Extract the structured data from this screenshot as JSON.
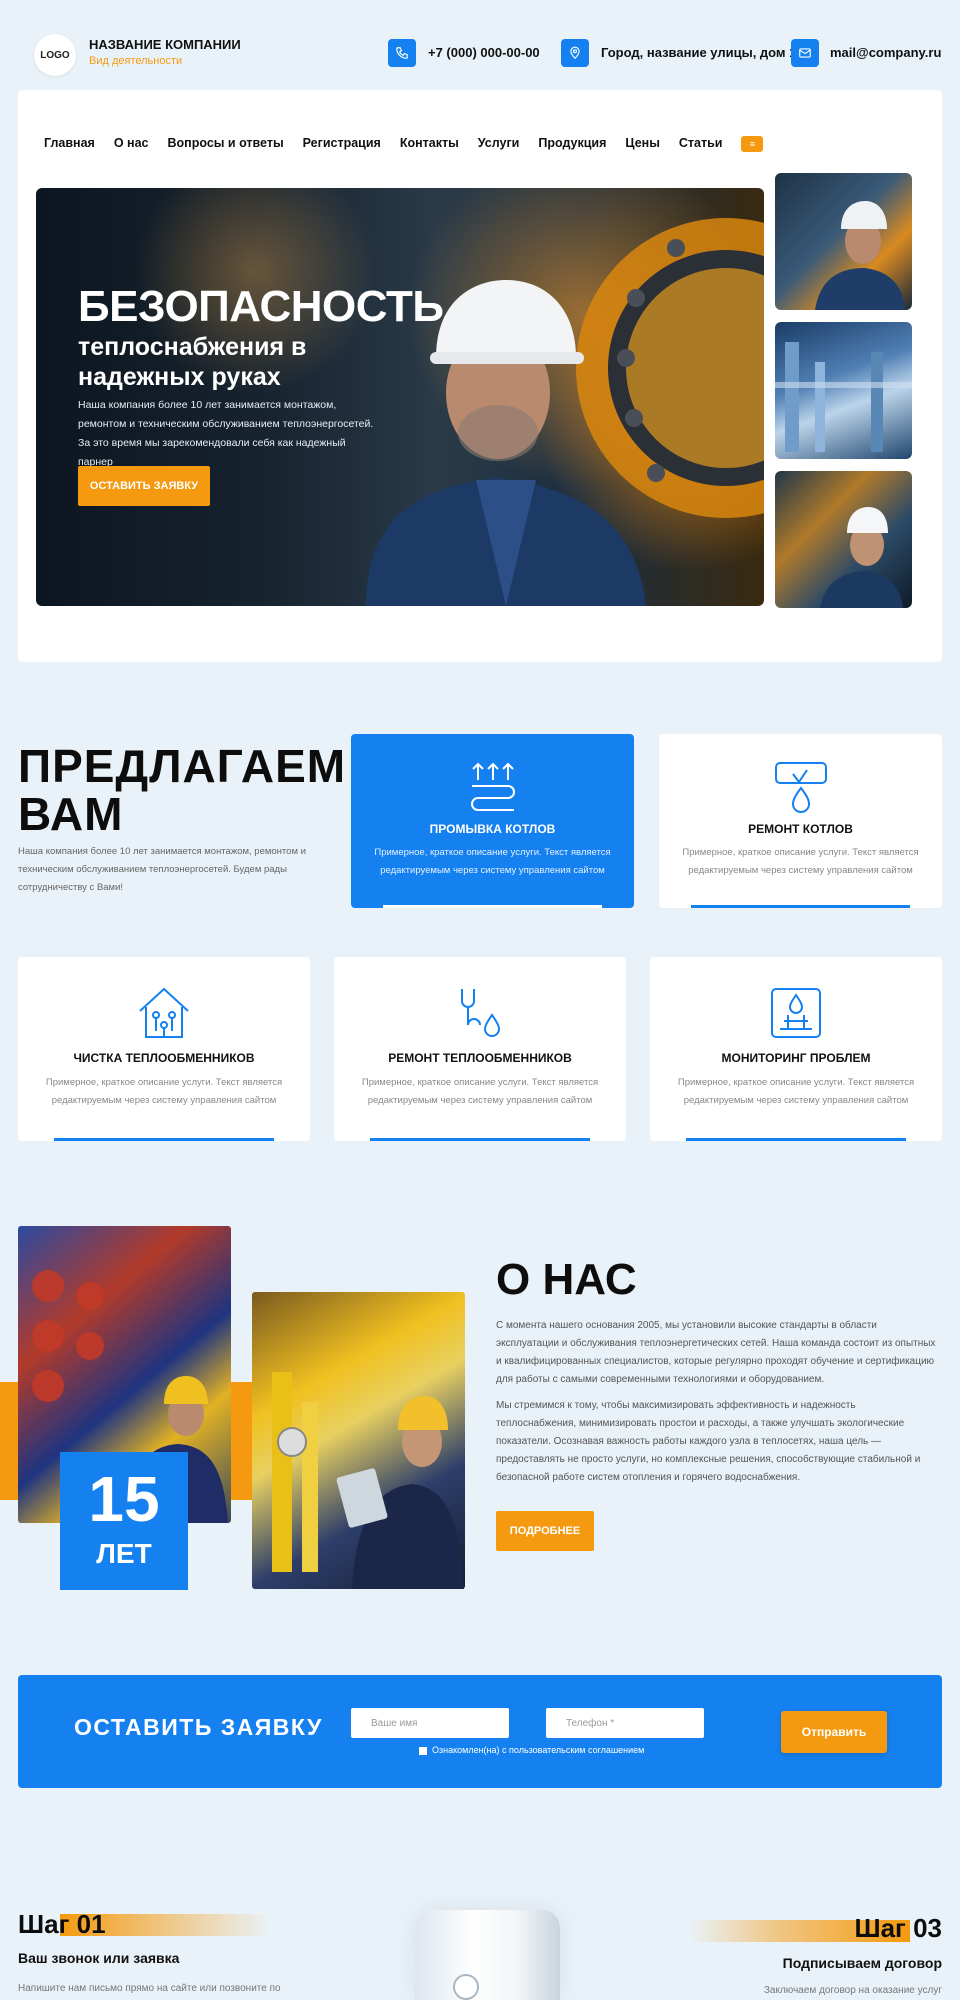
{
  "header": {
    "logo_text": "LOGO",
    "company_name": "НАЗВАНИЕ КОМПАНИИ",
    "company_subtitle": "Вид деятельности",
    "phone": "+7 (000) 000-00-00",
    "address": "Город, название улицы, дом 1",
    "email": "mail@company.ru"
  },
  "nav": {
    "items": [
      "Главная",
      "О нас",
      "Вопросы и ответы",
      "Регистрация",
      "Контакты",
      "Услуги",
      "Продукция",
      "Цены",
      "Статьи"
    ],
    "more_icon": "menu-more-icon"
  },
  "hero": {
    "title": "БЕЗОПАСНОСТЬ",
    "subtitle_line1": "теплоснабжения в",
    "subtitle_line2": "надежных руках",
    "text": "Наша компания более 10 лет занимается монтажом, ремонтом и техническим обслуживанием теплоэнергосетей. За это время мы зарекомендовали себя как надежный парнер",
    "button": "ОСТАВИТЬ ЗАЯВКУ"
  },
  "offer": {
    "title_line1": "ПРЕДЛАГАЕМ",
    "title_line2": "ВАМ",
    "text": "Наша компания более 10 лет занимается монтажом, ремонтом и техническим обслуживанием теплоэнергосетей. Будем рады сотрудничеству с Вами!",
    "services": [
      {
        "title": "ПРОМЫВКА КОТЛОВ",
        "text": "Примерное, краткое описание услуги. Текст является редактируемым через систему управления сайтом",
        "icon": "heat-flow-icon"
      },
      {
        "title": "РЕМОНТ КОТЛОВ",
        "text": "Примерное, краткое описание услуги. Текст является редактируемым через систему управления сайтом",
        "icon": "pipe-drop-icon"
      },
      {
        "title": "ЧИСТКА ТЕПЛООБМЕННИКОВ",
        "text": "Примерное, краткое описание услуги. Текст является редактируемым через систему управления сайтом",
        "icon": "house-circuit-icon"
      },
      {
        "title": "РЕМОНТ ТЕПЛООБМЕННИКОВ",
        "text": "Примерное, краткое описание услуги. Текст является редактируемым через систему управления сайтом",
        "icon": "wrench-drop-icon"
      },
      {
        "title": "МОНИТОРИНГ ПРОБЛЕМ",
        "text": "Примерное, краткое описание услуги. Текст является редактируемым через систему управления сайтом",
        "icon": "monitor-drop-icon"
      }
    ]
  },
  "about": {
    "years_number": "15",
    "years_label": "ЛЕТ",
    "title": "О НАС",
    "paragraph1": "С момента нашего основания 2005, мы установили высокие стандарты в области эксплуатации и обслуживания теплоэнергетических сетей. Наша команда состоит из опытных и квалифицированных специалистов, которые регулярно проходят обучение и сертификацию для работы с самыми современными технологиями и оборудованием.",
    "paragraph2": "Мы стремимся к тому, чтобы максимизировать эффективность и надежность теплоснабжения, минимизировать простои и расходы, а также улучшать экологические показатели. Осознавая важность работы каждого узла в теплосетях, наша цель — предоставлять не просто услуги, но комплексные решения, способствующие стабильной и безопасной работе систем отопления и горячего водоснабжения.",
    "button": "ПОДРОБНЕЕ"
  },
  "form": {
    "title": "ОСТАВИТЬ  ЗАЯВКУ",
    "name_placeholder": "Ваше имя",
    "phone_placeholder": "Телефон *",
    "consent": "Ознакомлен(на) с пользовательским соглашением",
    "submit": "Отправить"
  },
  "steps": [
    {
      "number": "Шаг 01",
      "title": "Ваш звонок или заявка",
      "text": "Напишите нам письмо прямо на сайте или позвоните по"
    },
    {
      "number": "Шаг 03",
      "title": "Подписываем договор",
      "text": "Заключаем договор на оказание услуг"
    }
  ],
  "colors": {
    "accent_blue": "#1580f0",
    "accent_orange": "#f59a10",
    "background": "#e9f2f8"
  }
}
